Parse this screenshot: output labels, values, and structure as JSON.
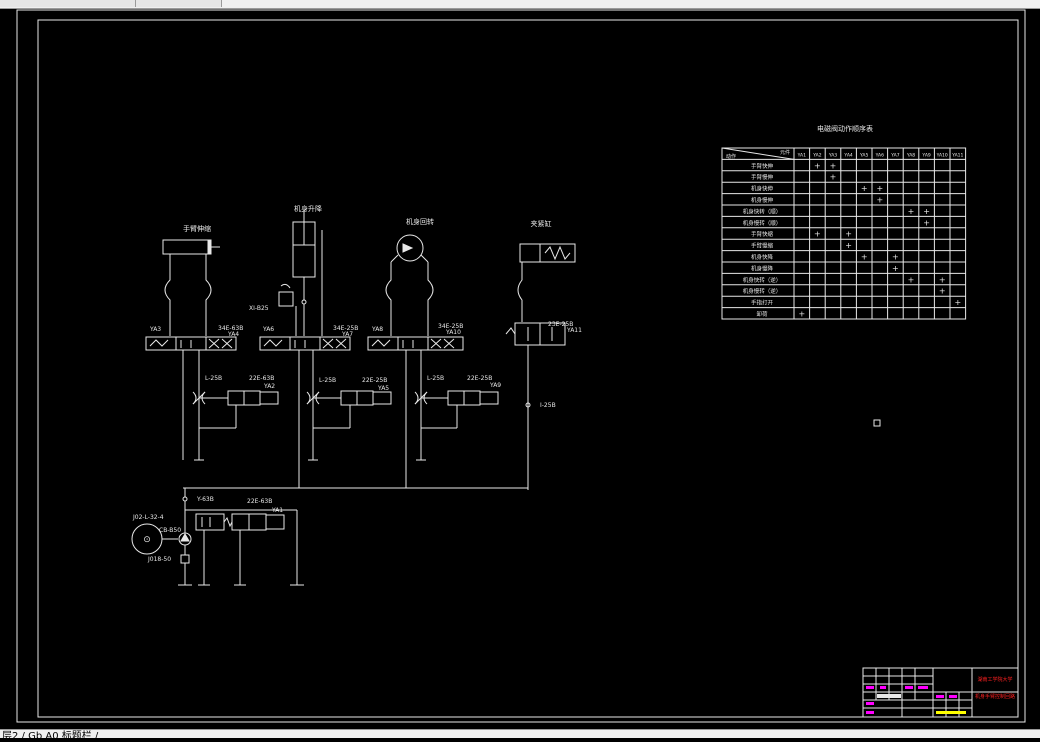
{
  "app": {
    "tab_label": "",
    "status_text": "层2 / Gb A0 标题栏 /"
  },
  "colors": {
    "line": "#e8e8e8",
    "background": "#000000",
    "magenta": "#ff00ff",
    "red": "#ff2020",
    "yellow": "#ffff00"
  },
  "diagram": {
    "section_labels": [
      "手臂伸缩",
      "机身升降",
      "机身回转",
      "夹紧缸"
    ],
    "labels": {
      "xi_b25": "XI-B25",
      "ya3": "YA3",
      "v1": "34E-63B",
      "ya4": "YA4",
      "ya6": "YA6",
      "v2": "34E-25B",
      "ya7": "YA7",
      "ya8": "YA8",
      "v3": "34E-25B",
      "ya10": "YA10",
      "v4": "23E-25B",
      "ya11": "YA11",
      "l1": "L-25B",
      "s1": "22E-63B",
      "ya2": "YA2",
      "l2": "L-25B",
      "s2": "22E-25B",
      "ya5": "YA5",
      "l3": "L-25B",
      "s3": "22E-25B",
      "ya9": "YA9",
      "i25b": "I-25B",
      "y63b": "Y-63B",
      "s4": "22E-63B",
      "ya1": "YA1",
      "motor": "J02-L-32-4",
      "pump": "CB-B50",
      "filter": "J018-50"
    }
  },
  "table": {
    "title": "电磁阀动作顺序表",
    "header_top": "元件",
    "header_bottom": "动作",
    "columns": [
      "YA1",
      "YA2",
      "YA3",
      "YA4",
      "YA5",
      "YA6",
      "YA7",
      "YA8",
      "YA9",
      "YA10",
      "YA11"
    ],
    "rows": [
      {
        "label": "手臂快伸",
        "marks": [
          2,
          3
        ]
      },
      {
        "label": "手臂慢伸",
        "marks": [
          3
        ]
      },
      {
        "label": "机身快伸",
        "marks": [
          5,
          6
        ]
      },
      {
        "label": "机身慢伸",
        "marks": [
          6
        ]
      },
      {
        "label": "机身快转（顺）",
        "marks": [
          8,
          9
        ]
      },
      {
        "label": "机身慢转（顺）",
        "marks": [
          9
        ]
      },
      {
        "label": "手臂快缩",
        "marks": [
          2,
          4
        ]
      },
      {
        "label": "手臂慢缩",
        "marks": [
          4
        ]
      },
      {
        "label": "机身快降",
        "marks": [
          5,
          7
        ]
      },
      {
        "label": "机身慢降",
        "marks": [
          7
        ]
      },
      {
        "label": "机身快转（逆）",
        "marks": [
          8,
          10
        ]
      },
      {
        "label": "机身慢转（逆）",
        "marks": [
          10
        ]
      },
      {
        "label": "手指打开",
        "marks": [
          11
        ]
      },
      {
        "label": "卸荷",
        "marks": [
          1
        ]
      }
    ],
    "mark_symbol": "+"
  },
  "titleblock": {
    "school": "湖南工学院大学",
    "drawing": "机身手臂控制回路"
  }
}
